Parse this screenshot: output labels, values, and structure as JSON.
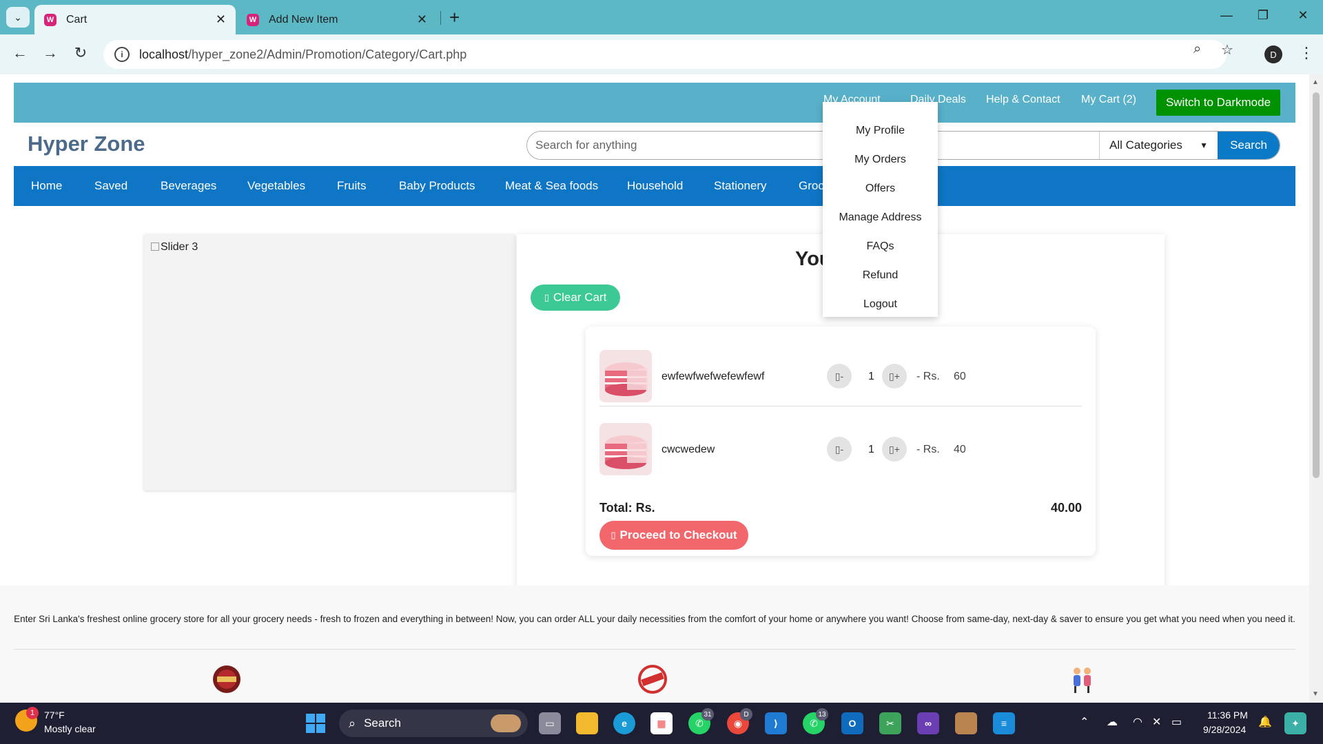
{
  "browser": {
    "tabs": [
      {
        "title": "Cart",
        "favicon": "W"
      },
      {
        "title": "Add New Item",
        "favicon": "W"
      }
    ],
    "url_host": "localhost",
    "url_path": "/hyper_zone2/Admin/Promotion/Category/Cart.php",
    "profile_initial": "D"
  },
  "topbar": {
    "my_account": "My Account",
    "daily_deals": "Daily Deals",
    "help": "Help & Contact",
    "my_cart": "My Cart (2)",
    "darkmode": "Switch to Darkmode"
  },
  "header": {
    "brand": "Hyper Zone",
    "search_placeholder": "Search for anything",
    "category_select": "All Categories",
    "search_button": "Search"
  },
  "categories": [
    "Home",
    "Saved",
    "Beverages",
    "Vegetables",
    "Fruits",
    "Baby Products",
    "Meat & Sea foods",
    "Household",
    "Stationery",
    "Groc"
  ],
  "account_menu": [
    "My Profile",
    "My Orders",
    "Offers",
    "Manage Address",
    "FAQs",
    "Refund",
    "Logout"
  ],
  "slider": {
    "alt_text": "Slider 3"
  },
  "cart": {
    "heading": "You",
    "clear_button": "Clear Cart",
    "items": [
      {
        "name": "ewfewfwefwefewfewf",
        "qty": "1",
        "minus": "-",
        "plus": "+",
        "price_prefix": "- Rs.",
        "price": "60"
      },
      {
        "name": "cwcwedew",
        "qty": "1",
        "minus": "-",
        "plus": "+",
        "price_prefix": "- Rs.",
        "price": "40"
      }
    ],
    "total_label": "Total: Rs.",
    "total_value": "40.00",
    "checkout_button": "Proceed to Checkout"
  },
  "footer": {
    "description": "Enter Sri Lanka's freshest online grocery store for all your grocery needs - fresh to frozen and everything in between! Now, you can order ALL your daily necessities from the comfort of your home or anywhere you want! Choose from same-day, next-day & saver to ensure you get what you need when you need it."
  },
  "taskbar": {
    "weather_temp": "77°F",
    "weather_desc": "Mostly clear",
    "weather_badge": "1",
    "search_label": "Search",
    "whatsapp_badge": "31",
    "chrome_badge": "D",
    "whatsapp2_badge": "13",
    "time": "11:36 PM",
    "date": "9/28/2024"
  },
  "colors": {
    "topstrip": "#58b1c9",
    "darkmode_button": "#009200",
    "category_nav": "#0e76c4",
    "clear_button": "#3cc993",
    "checkout_button": "#f2676c"
  }
}
